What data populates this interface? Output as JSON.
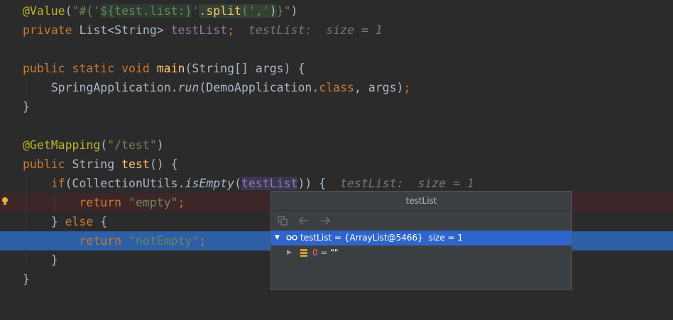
{
  "editor": {
    "l1": {
      "annot": "@Value",
      "open": "(",
      "q1": "\"",
      "hash": "#{",
      "sq1": "'",
      "tmpl": "${test.list:}",
      "sq2": "'",
      "dot": ".",
      "split": "split",
      "args": "(','",
      "close": ")",
      "brace": "}",
      "q2": "\"",
      "paren": ")"
    },
    "l2": {
      "kw": "private",
      "type": " List<String> ",
      "field": "testList",
      "semi": ";",
      "hint": "  testList:  size = 1"
    },
    "l4": {
      "kw": "public static void",
      "sp": " ",
      "fn": "main",
      "rest": "(String[] args) {"
    },
    "l5": {
      "indent": "    ",
      "cls": "SpringApplication.",
      "method": "run",
      "a": "(DemoApplication.",
      "kw": "class",
      "b": ", args)",
      "semi": ";"
    },
    "l6": {
      "text": "}"
    },
    "l8": {
      "annot": "@GetMapping",
      "open": "(",
      "str": "\"/test\"",
      "close": ")"
    },
    "l9": {
      "kw": "public",
      "type": " String ",
      "fn": "test",
      "rest": "() {"
    },
    "l10": {
      "indent": "    ",
      "kw": "if",
      "a": "(CollectionUtils.",
      "method": "isEmpty",
      "b": "(",
      "field": "testList",
      "c": ")) {",
      "hint": "  testList:  size = 1"
    },
    "l11": {
      "indent": "        ",
      "kw": "return",
      "sp": " ",
      "str": "\"empty\"",
      "semi": ";"
    },
    "l12": {
      "indent": "    ",
      "a": "} ",
      "kw": "else",
      "b": " {"
    },
    "l13": {
      "indent": "        ",
      "kw": "return",
      "sp": " ",
      "str": "\"notEmpty\"",
      "semi": ";"
    },
    "l14": {
      "indent": "    ",
      "text": "}"
    },
    "l15": {
      "text": "}"
    }
  },
  "popup": {
    "title": "testList",
    "toolbar": [
      "copy-icon",
      "back-arrow-icon",
      "forward-arrow-icon"
    ],
    "root": {
      "text": "testList = {ArrayList@5466}  size = 1"
    },
    "child": {
      "index": "0",
      "eq": " = ",
      "value": "\"\""
    }
  },
  "colors": {
    "background": "#2b2b2b",
    "keyword": "#cc7832",
    "annotation": "#bbb529",
    "string": "#6a8759",
    "method": "#ffc66d",
    "field": "#9876aa",
    "execution_line": "#2d5fa6",
    "error_line": "#3d2627"
  }
}
